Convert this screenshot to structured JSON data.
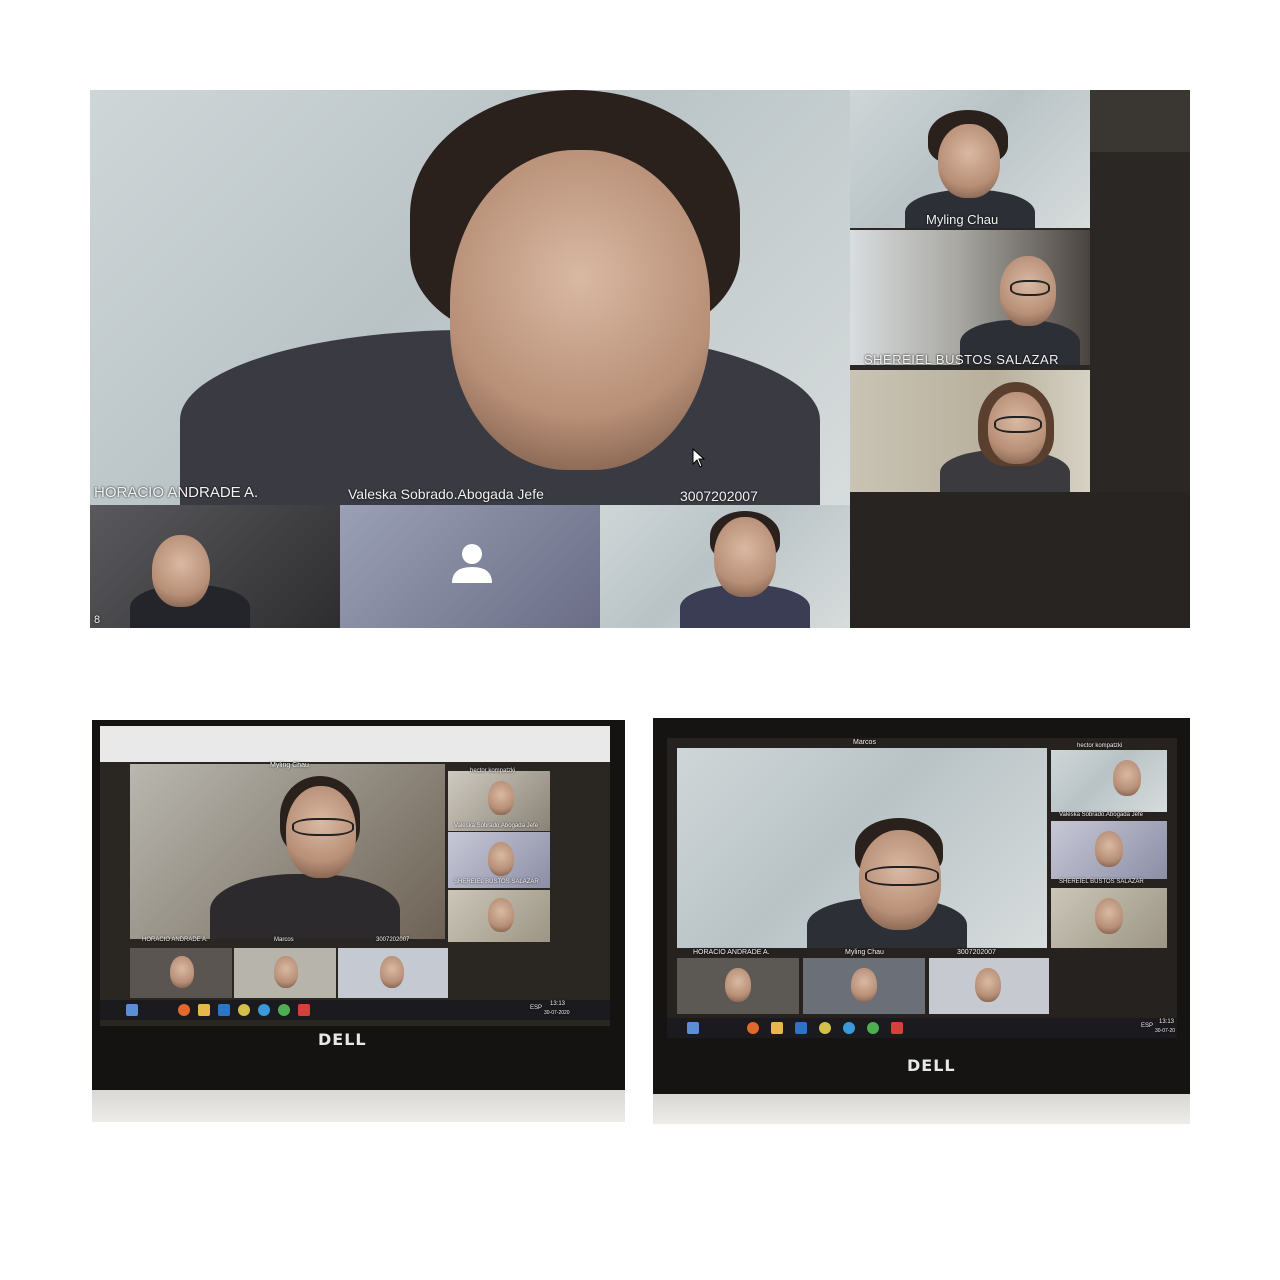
{
  "top_photo": {
    "gallery": {
      "main_speaker_name": "HORACIO ANDRADE A.",
      "tiles": [
        {
          "name": "Myling Chau"
        },
        {
          "name": "SHEREIEL BUSTOS SALAZAR"
        },
        {
          "name": "Valeska Sobrado.Abogada Jefe"
        },
        {
          "name": "3007202007"
        }
      ],
      "participant_count": "8"
    }
  },
  "bottom_left_photo": {
    "main_speaker_name": "Myling Chau",
    "side_tiles": [
      {
        "name": "hector kompatzki"
      },
      {
        "name": "Valeska Sobrado.Abogada Jefe"
      },
      {
        "name": "SHEREIEL BUSTOS SALAZAR"
      }
    ],
    "bottom_tiles": [
      {
        "name": "HORACIO ANDRADE A."
      },
      {
        "name": "Marcos"
      },
      {
        "name": "3007202007"
      }
    ],
    "taskbar": {
      "lang": "ESP",
      "time": "13:13",
      "date": "30-07-2020"
    },
    "brand": "DELL"
  },
  "bottom_right_photo": {
    "main_speaker_name": "Marcos",
    "side_tiles": [
      {
        "name": "hector kompatzki"
      },
      {
        "name": "Valeska Sobrado.Abogada Jefe"
      },
      {
        "name": "SHEREIEL BUSTOS SALAZAR"
      }
    ],
    "bottom_tiles": [
      {
        "name": "HORACIO ANDRADE A."
      },
      {
        "name": "Myling Chau"
      },
      {
        "name": "3007202007"
      }
    ],
    "taskbar": {
      "lang": "ESP",
      "time": "13:13",
      "date": "30-07-20"
    },
    "brand": "DELL"
  }
}
